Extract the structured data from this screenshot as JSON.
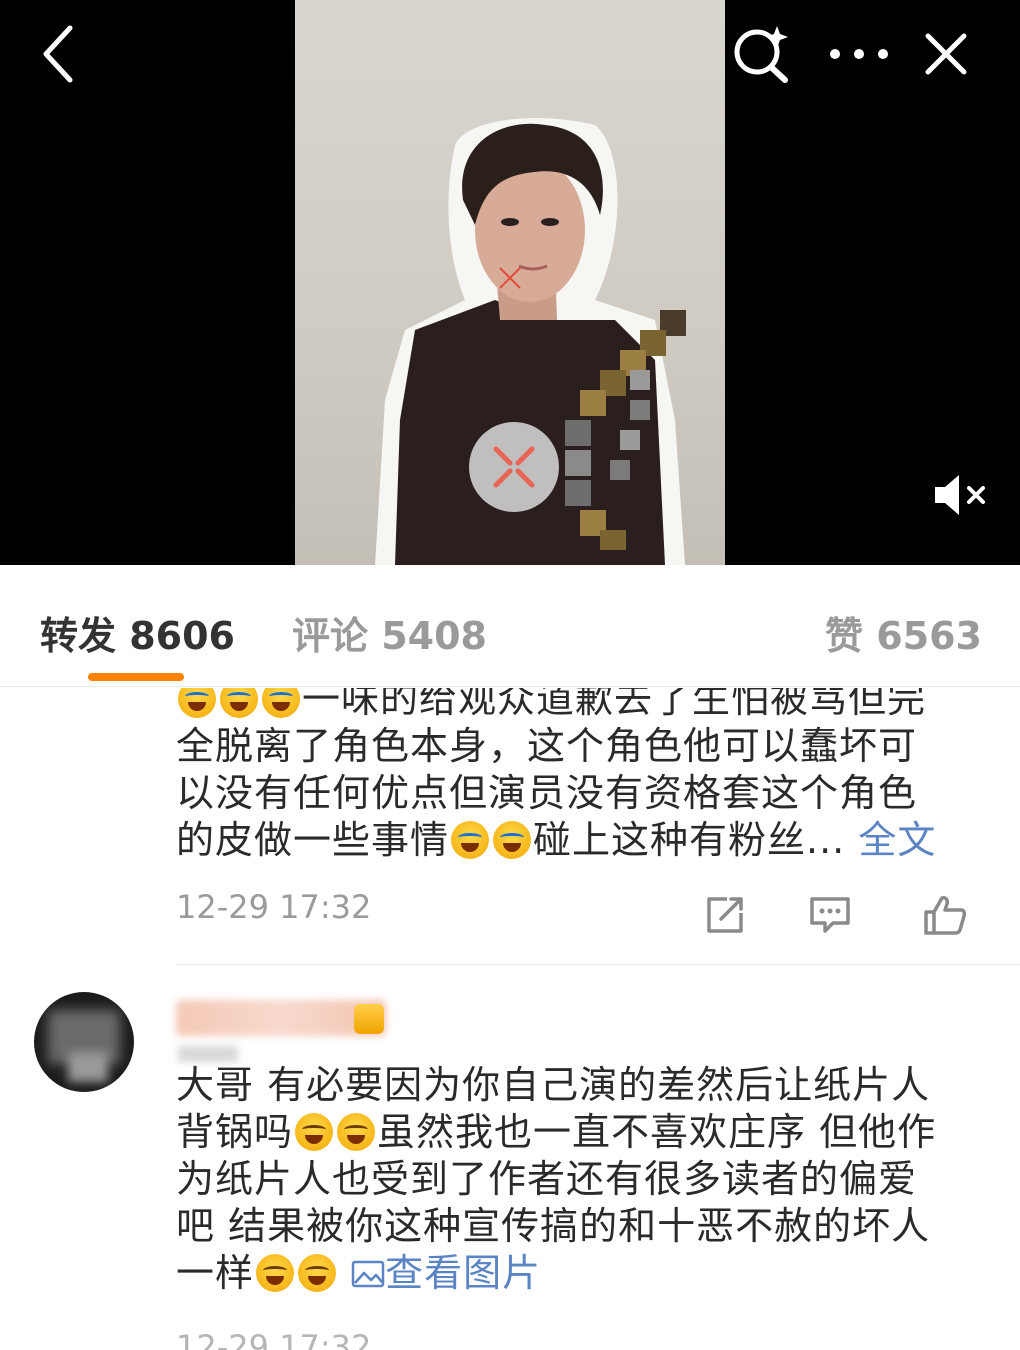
{
  "tabs": {
    "forward": "转发 8606",
    "comment": "评论 5408",
    "like": "赞 6563"
  },
  "comments": [
    {
      "partial_line": "一味的给观众道歉去了生怕被骂但完",
      "lines": [
        "全脱离了角色本身，这个角色他可以蠢坏可",
        "以没有任何优点但演员没有资格套这个角色",
        "的皮做一些事情",
        "碰上这种有粉丝...",
        "全文"
      ],
      "time": "12-29 17:32"
    },
    {
      "line1": "大哥 有必要因为你自己演的差然后让纸片人",
      "line2a": "背锅吗",
      "line2b": "虽然我也一直不喜欢庄序 但他作",
      "line3": "为纸片人也受到了作者还有很多读者的偏爱",
      "line4": "吧 结果被你这种宣传搞的和十恶不赦的坏人",
      "line5a": "一样",
      "view_image": "查看图片",
      "time": "12-29 17:32"
    }
  ],
  "icons": {
    "back": "chevron-left-icon",
    "search": "search-sparkle-icon",
    "more": "more-dots-icon",
    "close": "close-icon",
    "mute": "speaker-muted-icon",
    "share": "share-icon",
    "reply": "comment-icon",
    "like": "thumb-up-icon"
  },
  "colors": {
    "accent": "#ff8200",
    "link": "#5b84c4"
  }
}
